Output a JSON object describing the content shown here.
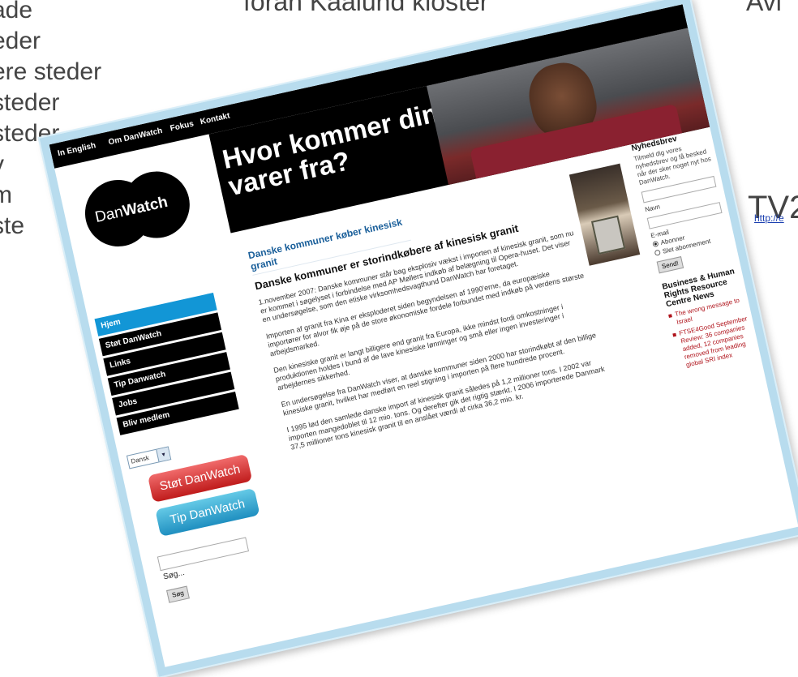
{
  "background_slide": {
    "left_lines": [
      "ade",
      "eder",
      "ere steder",
      "steder",
      "steder",
      "v",
      "m",
      "ste"
    ],
    "top_caption": "foran Kaalund kloster",
    "top_right": "Avi",
    "tv_label": "TV2",
    "link_fragment": "http://e"
  },
  "site": {
    "nav": [
      "In English",
      "Om DanWatch",
      "Fokus",
      "Kontakt"
    ],
    "hero_title": "Hvor kommer dine varer fra?",
    "logo": {
      "prefix": "Dan",
      "bold": "Watch"
    },
    "sidebar": [
      "Hjem",
      "Støt DanWatch",
      "Links",
      "Tip Danwatch",
      "Jobs",
      "Bliv medlem"
    ],
    "language": "Dansk",
    "support_button": "Støt DanWatch",
    "tip_button": "Tip DanWatch",
    "search_label": "Søg...",
    "search_button": "Søg"
  },
  "article": {
    "breadcrumb": "Danske kommuner køber kinesisk granit",
    "title": "Danske kommuner er storindkøbere af kinesisk granit",
    "paragraphs": [
      "1.november 2007: Danske kommuner står bag eksplosiv vækst i importen af kinesisk granit, som nu er kommet i søgelyset i forbindelse med AP Møllers indkøb af belægning til Opera-huset. Det viser en undersøgelse, som den etiske virksomhedsvagthund DanWatch har foretaget.",
      "Importen af granit fra Kina er eksploderet siden begyndelsen af 1990'erne, da europæiske importører for alvor fik øje på de store økonomiske fordele forbundet med indkøb på verdens største arbejdsmarked.",
      "Den kinesiske granit er langt billigere end granit fra Europa, ikke mindst fordi omkostninger i produktionen holdes i bund af de lave kinesiske lønninger og små eller ingen investeringer i arbejdernes sikkerhed.",
      "En undersøgelse fra DanWatch viser, at danske kommuner siden 2000 har storindkøbt af den billige kinesiske granit, hvilket har medført en reel stigning i importen på flere hundrede procent.",
      "I 1995 lød den samlede danske import af kinesisk granit således på 1,2 millioner tons. I 2002 var importen mangedoblet til 12 mio. tons. Og derefter gik det rigtig stærkt. I 2006 importerede Danmark 37,5 millioner tons kinesisk granit til en anslået værdi af cirka 36,2 mio. kr."
    ]
  },
  "newsletter": {
    "heading": "Nyhedsbrev",
    "text": "Tilmeld dig vores nyhedsbrev og få besked når der sker noget nyt hos DanWatch.",
    "name_label": "Navn",
    "email_label": "E-mail",
    "subscribe": "Abonner",
    "unsubscribe": "Slet abonnement",
    "send": "Send!"
  },
  "news": {
    "heading": "Business & Human Rights Resource Centre News",
    "items": [
      "The wrong message to Israel",
      "FTSE4Good September Review: 36 companies added, 12 companies removed from leading global SRI index"
    ]
  },
  "colors": {
    "nav_bg": "#000000",
    "active_item": "#1296d6",
    "support_button": "#c01c1c",
    "tip_button": "#1f8fc0",
    "news_link": "#b0141c",
    "frame": "#b8dcee"
  }
}
